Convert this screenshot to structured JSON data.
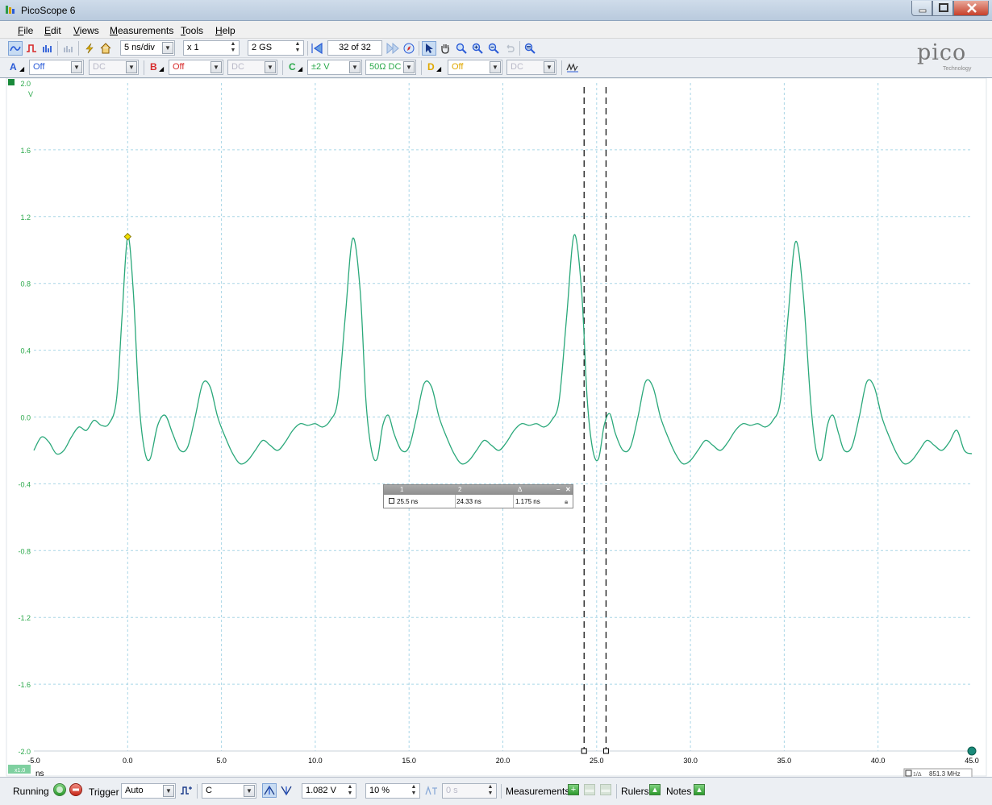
{
  "window": {
    "title": "PicoScope 6"
  },
  "menu": [
    "File",
    "Edit",
    "Views",
    "Measurements",
    "Tools",
    "Help"
  ],
  "toolbar1": {
    "timebase": "5 ns/div",
    "zoom": "x 1",
    "samples": "2 GS",
    "buffer": "32 of 32"
  },
  "channels": [
    {
      "label": "A",
      "range": "Off",
      "coupling": "DC",
      "color": "#2a5bd7"
    },
    {
      "label": "B",
      "range": "Off",
      "coupling": "DC",
      "color": "#d72a2a"
    },
    {
      "label": "C",
      "range": "±2 V",
      "coupling": "50Ω DC",
      "color": "#2aa84a"
    },
    {
      "label": "D",
      "range": "Off",
      "coupling": "DC",
      "color": "#e0a800"
    }
  ],
  "logo": {
    "word": "pico",
    "sub": "Technology"
  },
  "scope": {
    "y_unit": "V",
    "x_unit": "ns",
    "x_zoom": "x1.0",
    "freq_readout": "851.3 MHz",
    "freq_icon": "1/Δ",
    "trace_color": "#2aa87a",
    "axis_color": "#2aa84a"
  },
  "chart_data": {
    "type": "line",
    "title": "",
    "xlabel": "ns",
    "ylabel": "V",
    "xlim": [
      -5.0,
      45.0
    ],
    "ylim": [
      -2.0,
      2.0
    ],
    "x_ticks": [
      "-5.0",
      "0.0",
      "5.0",
      "10.0",
      "15.0",
      "20.0",
      "25.0",
      "30.0",
      "35.0",
      "40.0",
      "45.0"
    ],
    "y_ticks": [
      "2.0",
      "1.6",
      "1.2",
      "0.8",
      "0.4",
      "0.0",
      "-0.4",
      "-0.8",
      "-1.2",
      "-1.6",
      "-2.0"
    ],
    "grid": true,
    "series": [
      {
        "x": [
          -5.0,
          -4.6,
          -4.2,
          -3.8,
          -3.4,
          -3.0,
          -2.6,
          -2.2,
          -1.8,
          -1.4,
          -1.0,
          -0.6,
          -0.3,
          0.0,
          0.3,
          0.6,
          0.9,
          1.2,
          1.6,
          2.0,
          2.4,
          2.8,
          3.2,
          3.6,
          4.0,
          4.4,
          4.8,
          5.2,
          5.6,
          6.0,
          6.4,
          6.8,
          7.2,
          7.6,
          8.0,
          8.4,
          8.8,
          9.2,
          9.6,
          10.0,
          10.4,
          10.8,
          11.2,
          11.6,
          12.0,
          12.4,
          12.7,
          13.0,
          13.3,
          13.6,
          13.9,
          14.2,
          14.6,
          15.0,
          15.4,
          15.8,
          16.2,
          16.6,
          17.0,
          17.4,
          17.8,
          18.2,
          18.6,
          19.0,
          19.4,
          19.8,
          20.2,
          20.6,
          21.0,
          21.4,
          21.8,
          22.2,
          22.6,
          23.0,
          23.4,
          23.8,
          24.2,
          24.5,
          24.8,
          25.1,
          25.4,
          25.7,
          26.0,
          26.4,
          26.8,
          27.2,
          27.6,
          28.0,
          28.4,
          28.8,
          29.2,
          29.6,
          30.0,
          30.4,
          30.8,
          31.2,
          31.6,
          32.0,
          32.4,
          32.8,
          33.2,
          33.6,
          34.0,
          34.4,
          34.8,
          35.2,
          35.6,
          36.0,
          36.4,
          36.7,
          37.0,
          37.3,
          37.6,
          37.9,
          38.2,
          38.6,
          39.0,
          39.4,
          39.8,
          40.2,
          40.6,
          41.0,
          41.4,
          41.8,
          42.2,
          42.6,
          43.0,
          43.4,
          43.8,
          44.2,
          44.6,
          45.0
        ],
        "y": [
          -0.2,
          -0.12,
          -0.15,
          -0.22,
          -0.2,
          -0.12,
          -0.06,
          -0.08,
          -0.02,
          -0.05,
          -0.04,
          0.1,
          0.6,
          1.08,
          0.75,
          0.1,
          -0.2,
          -0.25,
          -0.05,
          0.01,
          -0.1,
          -0.2,
          -0.18,
          0.0,
          0.2,
          0.18,
          0.0,
          -0.12,
          -0.22,
          -0.28,
          -0.26,
          -0.2,
          -0.14,
          -0.17,
          -0.2,
          -0.15,
          -0.08,
          -0.04,
          -0.05,
          -0.04,
          -0.06,
          -0.02,
          0.1,
          0.6,
          1.07,
          0.75,
          0.1,
          -0.2,
          -0.25,
          -0.05,
          0.01,
          -0.1,
          -0.2,
          -0.18,
          0.0,
          0.2,
          0.18,
          0.0,
          -0.12,
          -0.22,
          -0.28,
          -0.26,
          -0.2,
          -0.14,
          -0.17,
          -0.2,
          -0.15,
          -0.08,
          -0.04,
          -0.05,
          -0.04,
          -0.06,
          -0.02,
          0.1,
          0.6,
          1.09,
          0.75,
          0.1,
          -0.2,
          -0.25,
          -0.05,
          0.02,
          -0.1,
          -0.2,
          -0.18,
          0.0,
          0.21,
          0.18,
          0.0,
          -0.12,
          -0.22,
          -0.28,
          -0.26,
          -0.2,
          -0.14,
          -0.17,
          -0.2,
          -0.15,
          -0.08,
          -0.04,
          -0.05,
          -0.04,
          -0.06,
          -0.02,
          0.1,
          0.6,
          1.05,
          0.75,
          0.1,
          -0.2,
          -0.25,
          -0.05,
          0.01,
          -0.1,
          -0.2,
          -0.18,
          0.0,
          0.21,
          0.18,
          0.0,
          -0.12,
          -0.22,
          -0.28,
          -0.26,
          -0.2,
          -0.14,
          -0.17,
          -0.2,
          -0.15,
          -0.08,
          -0.2,
          -0.22
        ]
      }
    ],
    "marker": {
      "x": 0.0,
      "y": 1.08
    },
    "rulers_x": [
      24.33,
      25.5
    ]
  },
  "cursor_table": {
    "headers": [
      "1",
      "2",
      "Δ"
    ],
    "values": [
      "25.5 ns",
      "24.33 ns",
      "1.175 ns"
    ]
  },
  "statusbar": {
    "state": "Running",
    "trigger_label": "Trigger",
    "trigger_mode": "Auto",
    "trigger_channel": "C",
    "threshold": "1.082 V",
    "pretrigger": "10 %",
    "delay": "0 s",
    "measurements_label": "Measurements",
    "rulers_label": "Rulers",
    "notes_label": "Notes"
  }
}
